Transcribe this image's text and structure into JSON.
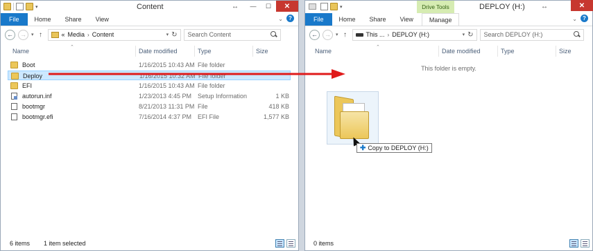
{
  "left": {
    "title": "Content",
    "tabs": {
      "file": "File",
      "home": "Home",
      "share": "Share",
      "view": "View"
    },
    "address": {
      "overflow": "«",
      "crumbs": [
        "Media",
        "Content"
      ]
    },
    "search_placeholder": "Search Content",
    "columns": {
      "name": "Name",
      "date": "Date modified",
      "type": "Type",
      "size": "Size"
    },
    "rows": [
      {
        "name": "Boot",
        "date": "1/16/2015 10:43 AM",
        "type": "File folder",
        "size": "",
        "icon": "folder-icon"
      },
      {
        "name": "Deploy",
        "date": "1/16/2015 10:32 AM",
        "type": "File folder",
        "size": "",
        "icon": "folder-icon"
      },
      {
        "name": "EFI",
        "date": "1/16/2015 10:43 AM",
        "type": "File folder",
        "size": "",
        "icon": "folder-icon"
      },
      {
        "name": "autorun.inf",
        "date": "1/23/2013 4:45 PM",
        "type": "Setup Information",
        "size": "1 KB",
        "icon": "setup-file-icon"
      },
      {
        "name": "bootmgr",
        "date": "8/21/2013 11:31 PM",
        "type": "File",
        "size": "418 KB",
        "icon": "file-icon"
      },
      {
        "name": "bootmgr.efi",
        "date": "7/16/2014 4:37 PM",
        "type": "EFI File",
        "size": "1,577 KB",
        "icon": "file-icon"
      }
    ],
    "selected_index": 1,
    "status": {
      "items": "6 items",
      "selected": "1 item selected"
    }
  },
  "right": {
    "title": "DEPLOY (H:)",
    "context_tab_group": "Drive Tools",
    "tabs": {
      "file": "File",
      "home": "Home",
      "share": "Share",
      "view": "View",
      "manage": "Manage"
    },
    "address": {
      "crumbs": [
        "This ...",
        "DEPLOY (H:)"
      ]
    },
    "search_placeholder": "Search DEPLOY (H:)",
    "columns": {
      "name": "Name",
      "date": "Date modified",
      "type": "Type",
      "size": "Size"
    },
    "empty_message": "This folder is empty.",
    "status": {
      "items": "0 items"
    }
  },
  "drag": {
    "tooltip": "Copy to DEPLOY (H:)"
  },
  "colors": {
    "accent": "#1979ca",
    "close": "#c7372f",
    "selection": "#cce8ff",
    "arrow": "#e01b1b",
    "drive_tools": "#d6ecb2"
  }
}
